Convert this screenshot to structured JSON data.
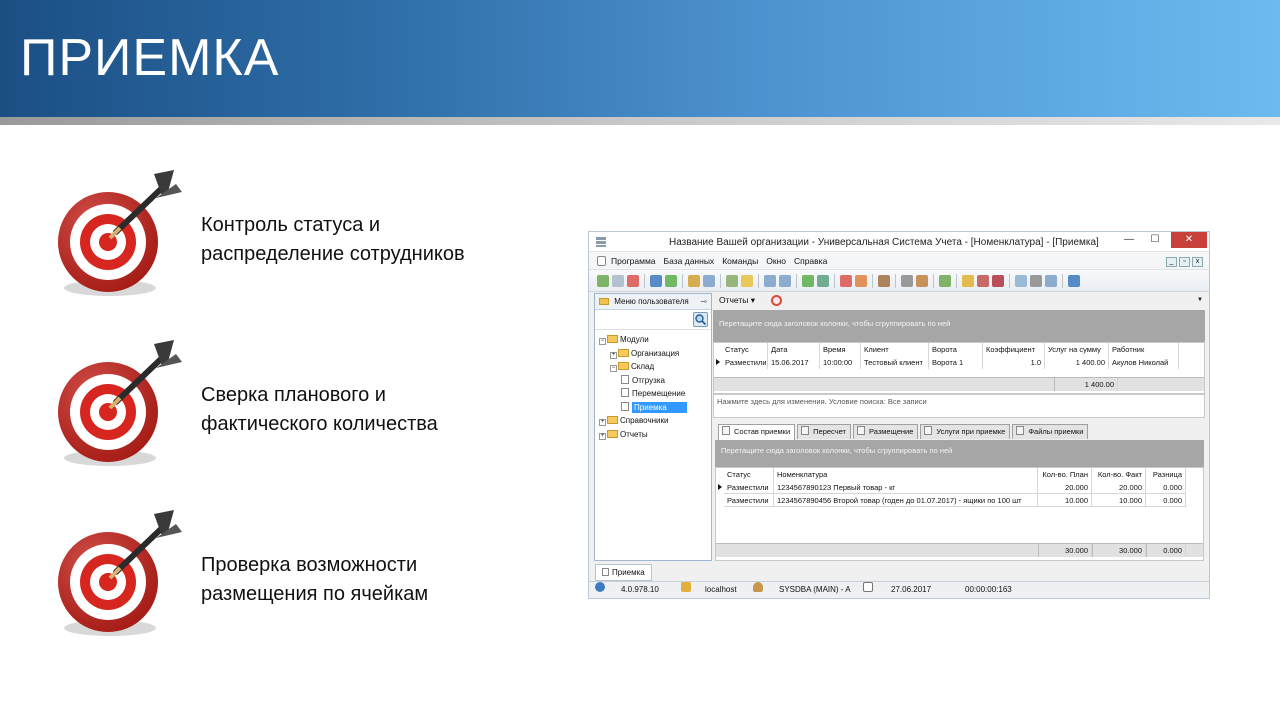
{
  "slide": {
    "title": "ПРИЕМКА",
    "bullets": [
      {
        "line1": "Контроль статуса и",
        "line2": "распределение сотрудников"
      },
      {
        "line1": "Сверка планового и",
        "line2": "фактического количества"
      },
      {
        "line1": "Проверка возможности",
        "line2": "размещения по ячейкам"
      }
    ]
  },
  "window": {
    "title": "Название Вашей организации - Универсальная Система Учета - [Номенклатура] - [Приемка]",
    "controls": {
      "minimize": "—",
      "maximize": "☐",
      "close": "✕"
    },
    "menu": [
      "Программа",
      "База данных",
      "Команды",
      "Окно",
      "Справка"
    ],
    "left_panel": {
      "title": "Меню пользователя",
      "tree": [
        {
          "label": "Модули",
          "level": 0,
          "exp": "−",
          "kind": "folder"
        },
        {
          "label": "Организация",
          "level": 1,
          "exp": "+",
          "kind": "folder"
        },
        {
          "label": "Склад",
          "level": 1,
          "exp": "−",
          "kind": "folder"
        },
        {
          "label": "Отгрузка",
          "level": 2,
          "kind": "doc"
        },
        {
          "label": "Перемещение",
          "level": 2,
          "kind": "doc"
        },
        {
          "label": "Приемка",
          "level": 2,
          "kind": "doc",
          "selected": true
        },
        {
          "label": "Справочники",
          "level": 0,
          "exp": "+",
          "kind": "folder"
        },
        {
          "label": "Отчеты",
          "level": 0,
          "exp": "+",
          "kind": "folder"
        }
      ]
    },
    "reports_label": "Отчеты ▾",
    "group_hint": "Перетащите сюда заголовок колонки, чтобы сгруппировать по ней",
    "grid1": {
      "columns": [
        "Статус",
        "Дата",
        "Время",
        "Клиент",
        "Ворота",
        "Коэффициент",
        "Услуг на сумму",
        "Работник"
      ],
      "rows": [
        [
          "Разместили",
          "15.06.2017",
          "10:00:00",
          "Тестовый клиент",
          "Ворота 1",
          "1.0",
          "1 400.00",
          "Акулов Николай"
        ]
      ],
      "footer_total": "1 400.00"
    },
    "filter_text": "Нажмите здесь для изменения. Условие поиска: Все записи",
    "detail_tabs": [
      "Состав приемки",
      "Пересчет",
      "Размещение",
      "Услуги при приемке",
      "Файлы приемки"
    ],
    "grid2": {
      "columns": [
        "Статус",
        "Номенклатура",
        "Кол-во. План",
        "Кол-во. Факт",
        "Разница"
      ],
      "rows": [
        [
          "Разместили",
          "1234567890123 Первый товар - кг",
          "20.000",
          "20.000",
          "0.000"
        ],
        [
          "Разместили",
          "1234567890456 Второй товар (годен до 01.07.2017) - ящики по 100 шт",
          "10.000",
          "10.000",
          "0.000"
        ]
      ],
      "footer": [
        "30.000",
        "30.000",
        "0.000"
      ]
    },
    "doc_tab": "Приемка",
    "status": {
      "version": "4.0.978.10",
      "host": "localhost",
      "user": "SYSDBA (MAIN) - A",
      "date": "27.06.2017",
      "timer": "00:00:00:163"
    }
  }
}
